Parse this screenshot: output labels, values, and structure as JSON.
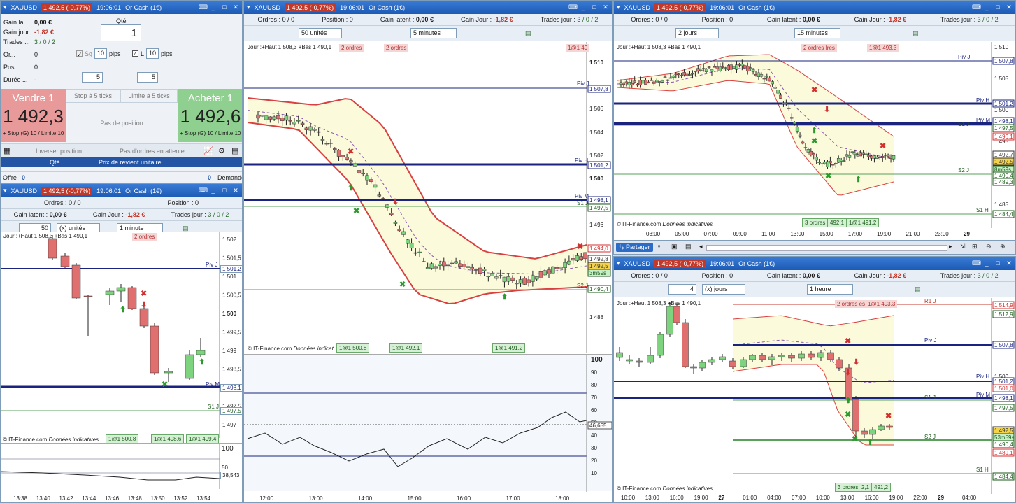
{
  "instrument": "XAUUSD",
  "price_change": "1 492,5 (-0,77%)",
  "time": "19:06:01",
  "account": "Or Cash (1€)",
  "summary": {
    "gain_latent_label": "Gain la...",
    "gain_latent": "0,00 €",
    "gain_jour_label": "Gain jour",
    "gain_jour": "-1,82 €",
    "trades_label": "Trades ...",
    "trades": "3 / 0 / 2",
    "orders_label": "Or...",
    "orders": "0",
    "pos_label": "Pos...",
    "pos": "0",
    "duree_label": "Durée ...",
    "duree": "-"
  },
  "order_panel": {
    "qty_label": "Qté",
    "qty": "1",
    "sg_label": "Sg",
    "sg_val": "10",
    "l_label": "L",
    "l_val": "10",
    "pips": "pips",
    "step1": "5",
    "step2": "5",
    "stop_btn": "Stop à 5 ticks",
    "limit_btn": "Limite à 5 ticks",
    "sell_label": "Vendre 1",
    "sell_price": "1 492,3",
    "sell_sub": "+ Stop (G) 10 / Limite 10",
    "buy_label": "Acheter 1",
    "buy_price": "1 492,6",
    "buy_sub": "+ Stop (G) 10 / Limite 10",
    "no_position": "Pas de position",
    "invert": "Inverser position",
    "no_orders": "Pas d'ordres en attente",
    "col_qty": "Qté",
    "col_prix": "Prix de revient unitaire",
    "offre": "Offre",
    "offre_val": "0",
    "demande": "Demande",
    "demande_val": "0"
  },
  "info": {
    "ordres": "Ordres :",
    "ordres_v": "0",
    "ordres_v2": "/ 0",
    "ordres_v3": "/ 0",
    "position": "Position :",
    "position_v": "0",
    "gain_latent": "Gain latent :",
    "gain_latent_v": "0,00 €",
    "gain_jour": "Gain Jour :",
    "gain_jour_v": "-1,82 €",
    "trades": "Trades jour :",
    "trades_v": "3 / 0 / 2"
  },
  "chart1": {
    "qty": "50",
    "unit": "(x) unités",
    "tf": "1 minute",
    "jour": "Jour :+Haut 1 508,3 +Bas 1 490,1",
    "orders": "2 ordres",
    "prices": [
      "1 502",
      "1 501,5",
      "1 501",
      "1 500,5",
      "1 500",
      "1 499,5",
      "1 499",
      "1 498,5",
      "1 498",
      "1 497,5",
      "1 497"
    ],
    "tags": {
      "pivj": "Piv J",
      "pivm": "Piv M",
      "s1": "S1 J"
    },
    "boxes": [
      "1 501,2",
      "1 498,1",
      "1 497,5"
    ],
    "src": "© IT-Finance.com",
    "src2": "Données indicatives",
    "trades": [
      "1@1 500,8",
      "1@1 498,6",
      "1@1 499,4"
    ],
    "rsi_scale": [
      "100",
      "50"
    ],
    "rsi_val": "38,543",
    "times": [
      "13:38",
      "13:40",
      "13:42",
      "13:44",
      "13:46",
      "13:48",
      "13:50",
      "13:52",
      "13:54"
    ]
  },
  "chart2": {
    "qty": "50 unités",
    "tf": "5 minutes",
    "jour": "Jour :+Haut 1 508,3 +Bas 1 490,1",
    "orders": "2 ordres",
    "orders2": "2 ordres",
    "top_tag": "1@1 49",
    "prices": [
      "1 510",
      "1 506",
      "1 504",
      "1 502",
      "1 500",
      "1 496",
      "1 494",
      "1 488"
    ],
    "boxes": [
      "1 507,8",
      "1 501,2",
      "1 498,1",
      "1 497,5",
      "1 494,0",
      "1 492,8",
      "1 492,5",
      "3m59s",
      "1 490,4"
    ],
    "tags": {
      "pivj": "Piv J",
      "pivh": "Piv H",
      "pivm": "Piv M",
      "s1": "S1 J",
      "s2": "S2 J"
    },
    "src": "© IT-Finance.com",
    "src2": "Données indicat",
    "trades": [
      "1@1 500,8",
      "1@1 492,1",
      "1@1 491,2"
    ],
    "rsi_scale": [
      "100",
      "90",
      "80",
      "70",
      "60",
      "50",
      "40",
      "30",
      "20",
      "10"
    ],
    "rsi_val": "46,655",
    "times": [
      "12:00",
      "13:00",
      "14:00",
      "15:00",
      "16:00",
      "17:00",
      "18:00"
    ]
  },
  "chart3": {
    "period": "2 jours",
    "tf": "15 minutes",
    "jour": "Jour :+Haut 1 508,3 +Bas 1 490,1",
    "orders": "2 ordres Ires",
    "top_tag": "1@1 493,3",
    "prices": [
      "1 510",
      "1 505",
      "1 500",
      "1 495",
      "1 490",
      "1 485"
    ],
    "boxes": [
      "1 507,8",
      "1 501,2",
      "1 498,1",
      "1 497,5",
      "1 496,1",
      "1 492,7",
      "1 492,5",
      "8m59s",
      "1 490,4",
      "1 489,3",
      "1 484,4"
    ],
    "tags": {
      "pivj": "Piv J",
      "pivh": "Piv H",
      "pivm": "Piv M",
      "s1": "S1 J",
      "s2": "S2 J",
      "s1b": "S1 H"
    },
    "src": "© IT-Finance.com",
    "src2": "Données indicatives",
    "trades": [
      "3 ordres",
      "492,1",
      "1@1 491,2"
    ],
    "times": [
      "03:00",
      "05:00",
      "07:00",
      "09:00",
      "11:00",
      "13:00",
      "15:00",
      "17:00",
      "19:00",
      "21:00",
      "23:00",
      "29"
    ]
  },
  "share": {
    "label": "Partager"
  },
  "chart4": {
    "period": "4",
    "unit": "(x) jours",
    "tf": "1 heure",
    "jour": "Jour :+Haut 1 508,3 +Bas 1 490,1",
    "orders": "2 ordres es",
    "top_tag": "1@1 493,3",
    "prices": [
      "1 505",
      "1 500",
      "1 495",
      "1 490"
    ],
    "boxes": [
      "1 514,9",
      "1 512,9",
      "1 507,8",
      "1 501,2",
      "1 501,0",
      "1 498,1",
      "1 497,5",
      "1 492,5",
      "53m59s",
      "1 490,4",
      "1 489,1",
      "1 484,4"
    ],
    "tags": {
      "r1": "R1 J",
      "pivj": "Piv J",
      "pivh": "Piv H",
      "pivm": "Piv M",
      "s1": "S1 J",
      "s2": "S2 J",
      "s1b": "S1 H"
    },
    "src": "© IT-Finance.com",
    "src2": "Données indicatives",
    "trades": [
      "3 ordres",
      "2,1",
      "491,2"
    ],
    "times": [
      "10:00",
      "13:00",
      "16:00",
      "19:00",
      "27",
      "01:00",
      "04:00",
      "07:00",
      "10:00",
      "13:00",
      "16:00",
      "19:00",
      "22:00",
      "29",
      "04:00"
    ]
  }
}
